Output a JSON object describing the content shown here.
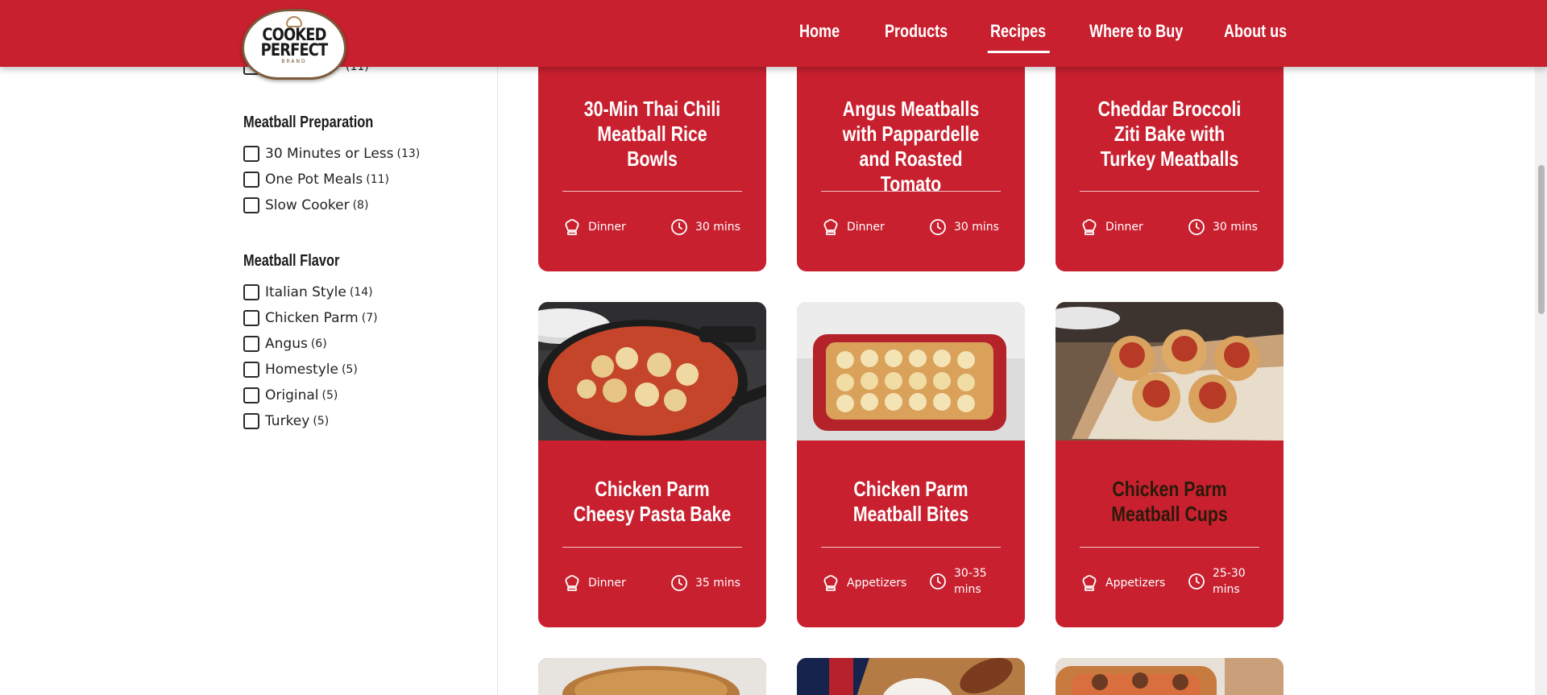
{
  "brand": {
    "logo_line1": "COOKED",
    "logo_line2": "PERFECT",
    "logo_line3": "BRAND"
  },
  "nav": {
    "items": [
      {
        "label": "Home"
      },
      {
        "label": "Products"
      },
      {
        "label": "Recipes",
        "active": true
      },
      {
        "label": "Where to Buy"
      },
      {
        "label": "About us"
      }
    ]
  },
  "sidebar": {
    "partial_row": {
      "count": "(11)"
    },
    "groups": [
      {
        "title": "Meatball Preparation",
        "options": [
          {
            "label": "30 Minutes or Less",
            "count": "(13)"
          },
          {
            "label": "One Pot Meals",
            "count": "(11)"
          },
          {
            "label": "Slow Cooker",
            "count": "(8)"
          }
        ]
      },
      {
        "title": "Meatball Flavor",
        "options": [
          {
            "label": "Italian Style",
            "count": "(14)"
          },
          {
            "label": "Chicken Parm",
            "count": "(7)"
          },
          {
            "label": "Angus",
            "count": "(6)"
          },
          {
            "label": "Homestyle",
            "count": "(5)"
          },
          {
            "label": "Original",
            "count": "(5)"
          },
          {
            "label": "Turkey",
            "count": "(5)"
          }
        ]
      }
    ]
  },
  "recipes": [
    {
      "title": "30-Min Thai Chili Meatball Rice Bowls",
      "category": "Dinner",
      "time": "30 mins",
      "image": "none"
    },
    {
      "title": "Angus Meatballs with Pappardelle and Roasted Tomato",
      "category": "Dinner",
      "time": "30 mins",
      "image": "none"
    },
    {
      "title": "Cheddar Broccoli Ziti Bake with Turkey Meatballs",
      "category": "Dinner",
      "time": "30 mins",
      "image": "none"
    },
    {
      "title": "Chicken Parm Cheesy Pasta Bake",
      "category": "Dinner",
      "time": "35 mins",
      "image": "skillet-pasta-photo"
    },
    {
      "title": "Chicken Parm Meatball Bites",
      "category": "Appetizers",
      "time": "30-35 mins",
      "image": "casserole-dish-photo"
    },
    {
      "title": "Chicken Parm Meatball Cups",
      "category": "Appetizers",
      "time": "25-30 mins",
      "image": "meatball-cups-photo"
    }
  ],
  "icons": {
    "category": "chef-hat-icon",
    "time": "clock-icon"
  },
  "colors": {
    "brand_red": "#c8202f",
    "text_dark": "#222222"
  }
}
